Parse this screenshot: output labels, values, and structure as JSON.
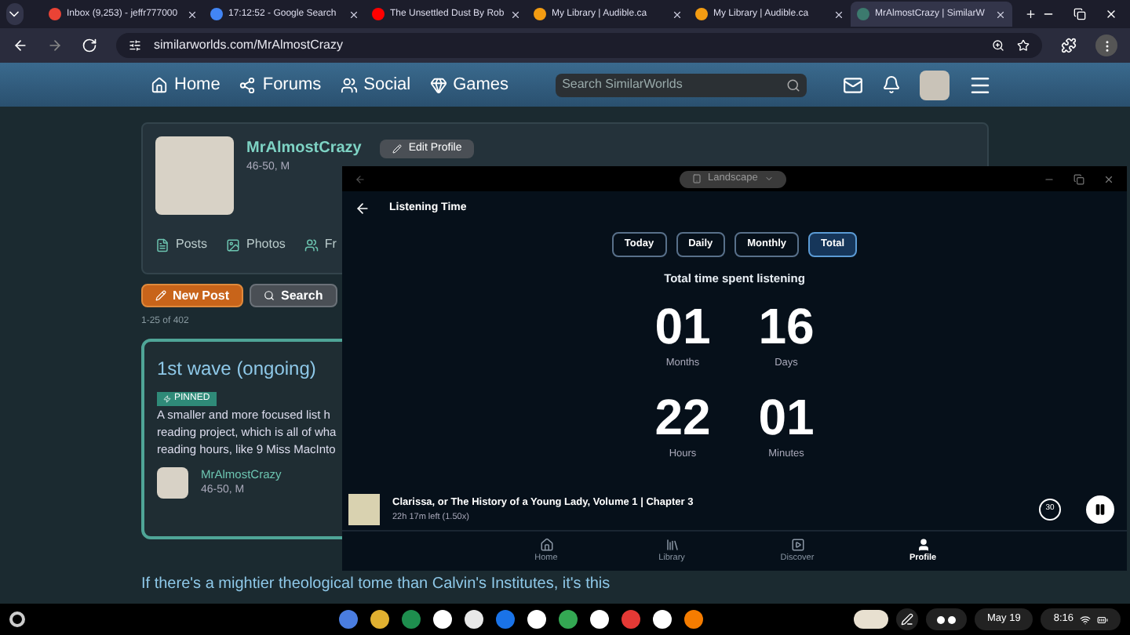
{
  "browser": {
    "tabs": [
      {
        "title": "Inbox (9,253) - jeffr777000",
        "kind": "mail",
        "selected": false
      },
      {
        "title": "17:12:52 - Google Search",
        "kind": "search",
        "selected": false
      },
      {
        "title": "The Unsettled Dust By Rob",
        "kind": "video",
        "selected": false
      },
      {
        "title": "My Library | Audible.ca",
        "kind": "books",
        "selected": false
      },
      {
        "title": "My Library | Audible.ca",
        "kind": "books",
        "selected": false
      },
      {
        "title": "MrAlmostCrazy | SimilarW",
        "kind": "site",
        "selected": true
      }
    ],
    "address": "similarworlds.com/MrAlmostCrazy"
  },
  "site_nav": {
    "items": [
      {
        "label": "Home",
        "kind": "home"
      },
      {
        "label": "Forums",
        "kind": "forums"
      },
      {
        "label": "Social",
        "kind": "social"
      },
      {
        "label": "Games",
        "kind": "games"
      }
    ],
    "search_placeholder": "Search SimilarWorlds"
  },
  "profile": {
    "name": "MrAlmostCrazy",
    "meta": "46-50, M",
    "edit_button": "Edit Profile",
    "links": [
      {
        "label": "Posts",
        "kind": "posts"
      },
      {
        "label": "Photos",
        "kind": "photos"
      },
      {
        "label": "Fr",
        "kind": "friends"
      }
    ]
  },
  "actions": [
    {
      "label": "New Post",
      "kind": "primary"
    },
    {
      "label": "Search",
      "kind": "secondary"
    }
  ],
  "count": "1-25 of 402",
  "post": {
    "title": "1st wave (ongoing)",
    "badge": "PINNED",
    "lines": [
      "A smaller and more focused list h",
      "reading project, which is all of wha",
      "reading hours, like 9 Miss MacInto"
    ],
    "author": "MrAlmostCrazy",
    "author_meta": "46-50, M"
  },
  "next_post_title": "If there's a mightier theological tome than Calvin's Institutes, it's this",
  "app_window": {
    "orientation": "Landscape",
    "screen_title": "Listening Time",
    "filters": [
      {
        "label": "Today",
        "selected": false
      },
      {
        "label": "Daily",
        "selected": false
      },
      {
        "label": "Monthly",
        "selected": false
      },
      {
        "label": "Total",
        "selected": true
      }
    ],
    "subtitle": "Total time spent listening",
    "stats": [
      {
        "value": "01",
        "unit": "Months"
      },
      {
        "value": "16",
        "unit": "Days"
      },
      {
        "value": "22",
        "unit": "Hours"
      },
      {
        "value": "01",
        "unit": "Minutes"
      }
    ],
    "player": {
      "title": "Clarissa, or The History of a Young Lady, Volume 1 | Chapter 3",
      "detail": "22h 17m left (1.50x)",
      "skip": "30",
      "playing": true
    },
    "nav": [
      {
        "label": "Home",
        "kind": "home",
        "selected": false
      },
      {
        "label": "Library",
        "kind": "library",
        "selected": false
      },
      {
        "label": "Discover",
        "kind": "discover",
        "selected": false
      },
      {
        "label": "Profile",
        "kind": "profile",
        "selected": true
      }
    ]
  },
  "shelf": {
    "date": "May 19",
    "time": "8:16"
  }
}
